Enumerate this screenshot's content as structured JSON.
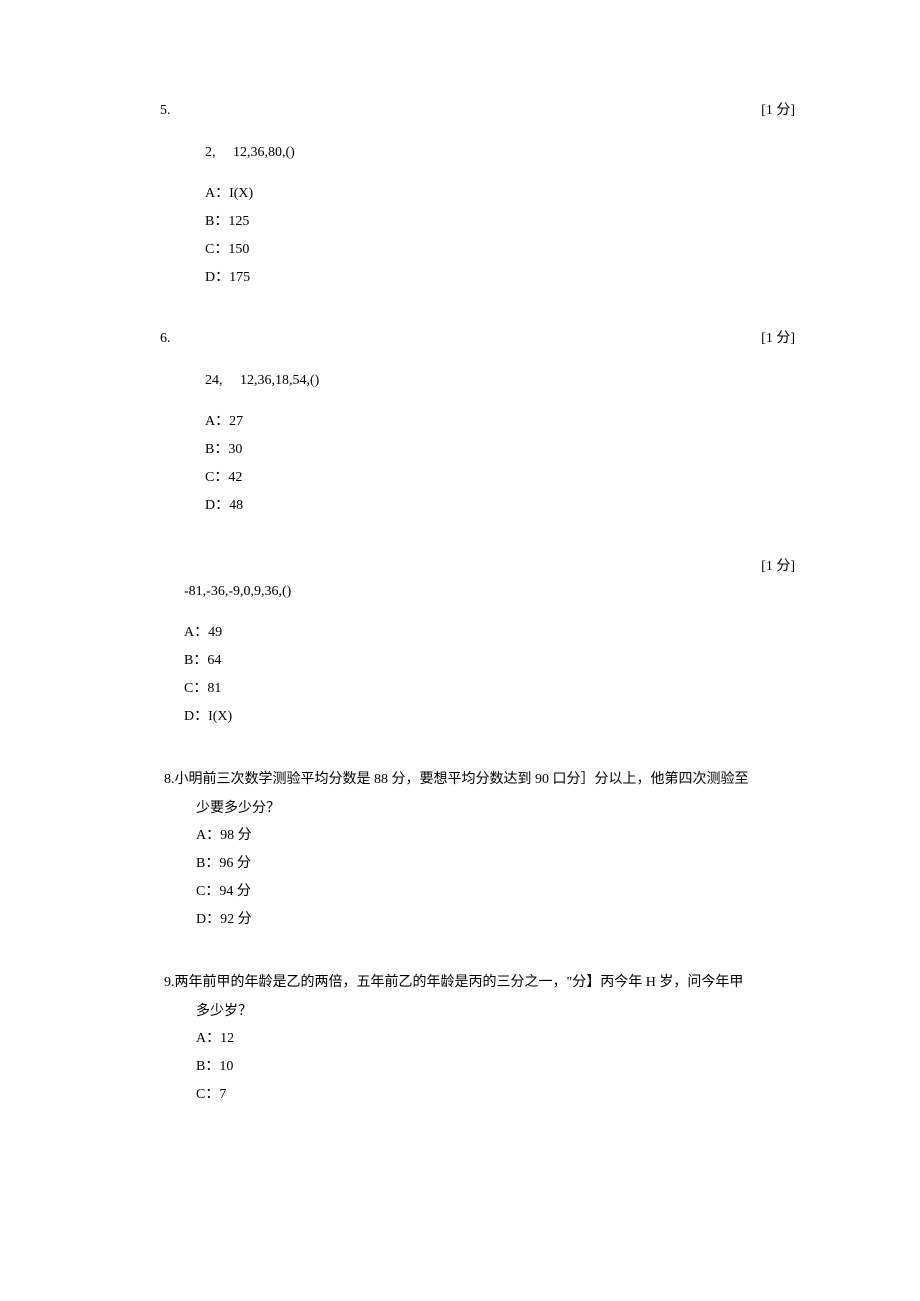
{
  "questions": [
    {
      "number": "5.",
      "points": "[1 分]",
      "seq_first": "2,",
      "seq_rest": "12,36,80,()",
      "options": [
        "A：I(X)",
        "B：125",
        "C：150",
        "D：175"
      ]
    },
    {
      "number": "6.",
      "points": "[1 分]",
      "seq_first": "24,",
      "seq_rest": "12,36,18,54,()",
      "options": [
        "A：27",
        "B：30",
        "C：42",
        "D：48"
      ]
    },
    {
      "number": "",
      "points": "[1 分]",
      "seq_first": "",
      "seq_rest": "-81,-36,-9,0,9,36,()",
      "options": [
        "A：49",
        "B：64",
        "C：81",
        "D：I(X)"
      ]
    }
  ],
  "inline_questions": [
    {
      "number": "8.",
      "text_line": "小明前三次数学测验平均分数是 88 分，要想平均分数达到 90 口分］分以上，他第四次测验至",
      "cont": "少要多少分？",
      "options": [
        "A：98 分",
        "B：96 分",
        "C：94 分",
        "D：92 分"
      ]
    },
    {
      "number": "9.",
      "text_line": "两年前甲的年龄是乙的两倍，五年前乙的年龄是丙的三分之一，\"分】丙今年 H 岁，问今年甲",
      "cont": "多少岁？",
      "options": [
        "A：12",
        "B：10",
        "C：7"
      ]
    }
  ]
}
